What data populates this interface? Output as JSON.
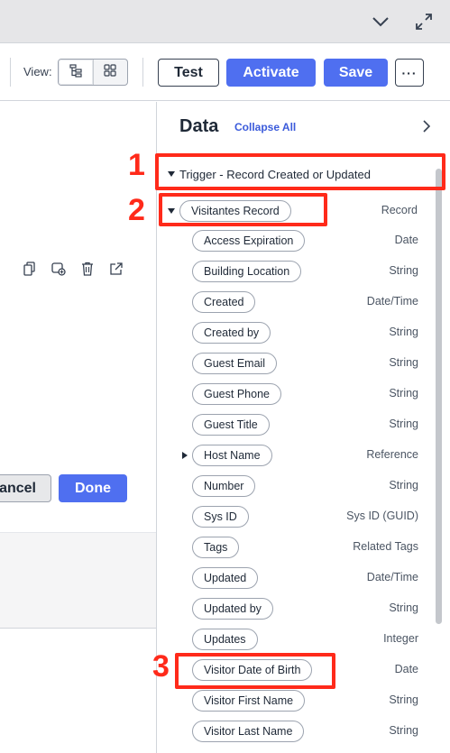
{
  "toolbar": {
    "view_label": "View:",
    "test_label": "Test",
    "activate_label": "Activate",
    "save_label": "Save",
    "more_label": "···"
  },
  "left": {
    "cancel_label": "Cancel",
    "done_label": "Done"
  },
  "data_panel": {
    "title": "Data",
    "collapse_all": "Collapse All",
    "trigger_label": "Trigger - Record Created or Updated",
    "record": {
      "label": "Visitantes Record",
      "type": "Record"
    },
    "fields": [
      {
        "label": "Access Expiration",
        "type": "Date"
      },
      {
        "label": "Building Location",
        "type": "String"
      },
      {
        "label": "Created",
        "type": "Date/Time"
      },
      {
        "label": "Created by",
        "type": "String"
      },
      {
        "label": "Guest Email",
        "type": "String"
      },
      {
        "label": "Guest Phone",
        "type": "String"
      },
      {
        "label": "Guest Title",
        "type": "String"
      },
      {
        "label": "Host Name",
        "type": "Reference",
        "expandable": true
      },
      {
        "label": "Number",
        "type": "String"
      },
      {
        "label": "Sys ID",
        "type": "Sys ID (GUID)"
      },
      {
        "label": "Tags",
        "type": "Related Tags"
      },
      {
        "label": "Updated",
        "type": "Date/Time"
      },
      {
        "label": "Updated by",
        "type": "String"
      },
      {
        "label": "Updates",
        "type": "Integer"
      },
      {
        "label": "Visitor Date of Birth",
        "type": "Date"
      },
      {
        "label": "Visitor First Name",
        "type": "String"
      },
      {
        "label": "Visitor Last Name",
        "type": "String"
      }
    ]
  },
  "annotations": [
    "1",
    "2",
    "3"
  ],
  "colors": {
    "primary": "#4f6ff0",
    "annotation": "#ff2a1a",
    "link": "#3b5bdb"
  }
}
